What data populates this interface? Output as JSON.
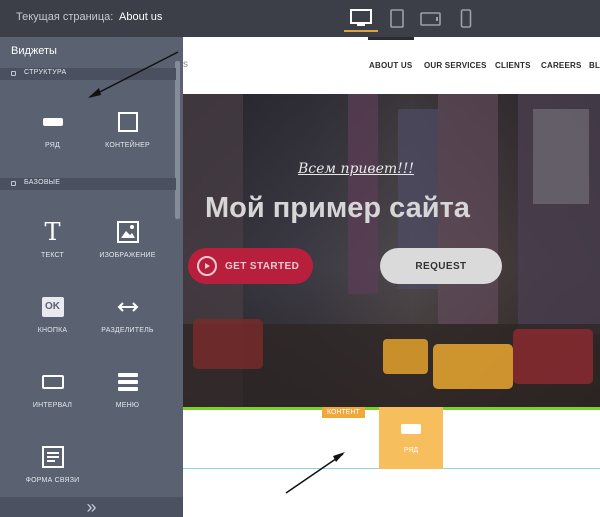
{
  "topbar": {
    "current_page_label": "Текущая страница:",
    "current_page_value": "About us"
  },
  "devices": [
    "desktop-icon",
    "tablet-portrait-icon",
    "tablet-landscape-icon",
    "phone-icon"
  ],
  "panel": {
    "title": "Виджеты",
    "sections": {
      "structure": "СТРУКТУРА",
      "basic": "БАЗОВЫЕ"
    },
    "widgets": {
      "row": "РЯД",
      "container": "КОНТЕЙНЕР",
      "text": "ТЕКСТ",
      "image": "ИЗОБРАЖЕНИЕ",
      "button": "КНОПКА",
      "button_icon_text": "OK",
      "divider": "РАЗДЕЛИТЕЛЬ",
      "spacer": "ИНТЕРВАЛ",
      "menu": "МЕНЮ",
      "form": "ФОРМА СВЯЗИ",
      "text_icon_glyph": "T"
    },
    "footer_glyph": "»"
  },
  "site": {
    "nav": {
      "partial_left": "s",
      "items": [
        "ABOUT US",
        "OUR SERVICES",
        "CLIENTS",
        "CAREERS",
        "BL"
      ]
    },
    "hero": {
      "greeting": "Всем привет!!!",
      "title": "Мой пример сайта",
      "get_started": "GET STARTED",
      "request": "REQUEST"
    },
    "content": {
      "badge": "КОНТЕНТ",
      "row_label": "РЯД"
    }
  },
  "colors": {
    "accent_active_device": "#d8a441",
    "get_started_bg": "#b71f3c",
    "content_border": "#7bd22a",
    "content_badge": "#f0a83b",
    "drop_row": "#f6be5c"
  }
}
